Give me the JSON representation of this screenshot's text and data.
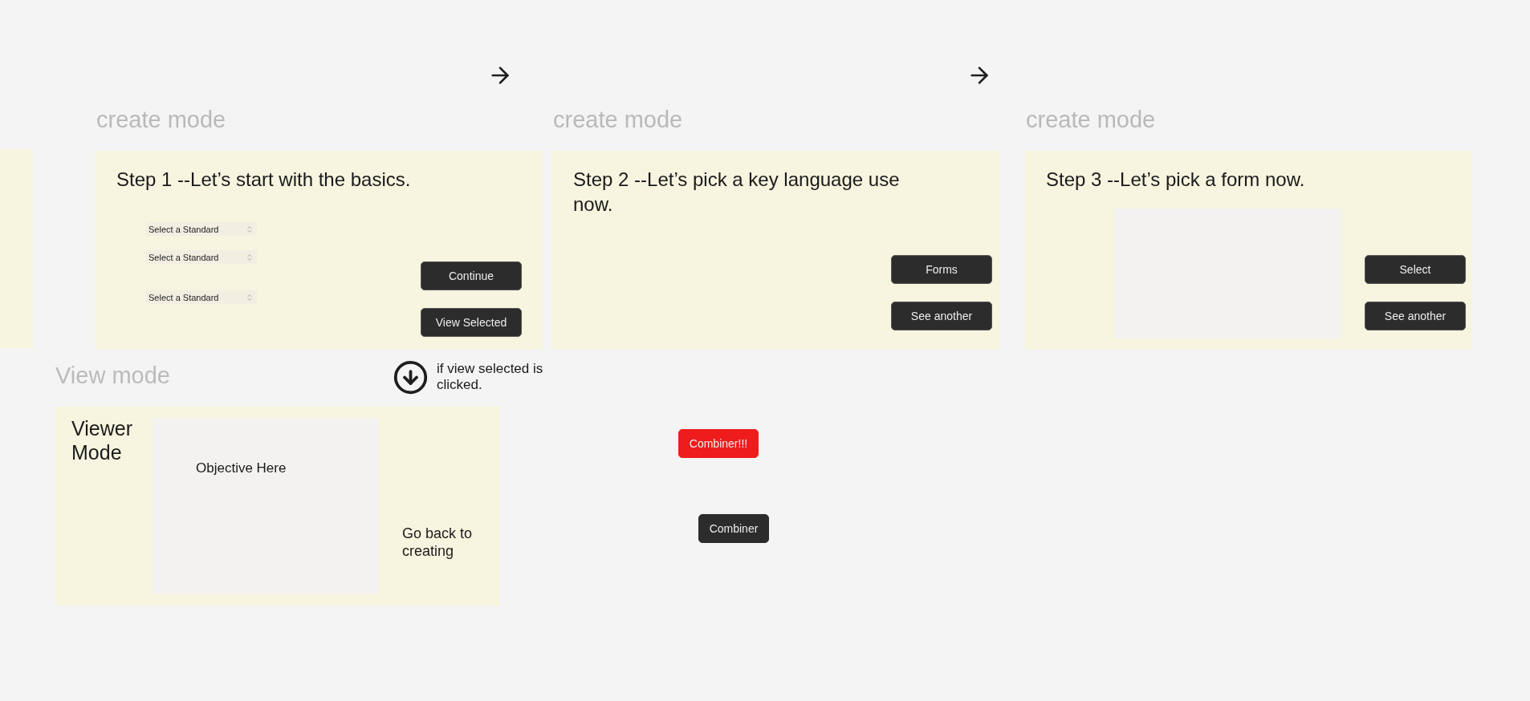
{
  "frames": [
    {
      "label": "create mode",
      "title": "Step 1 --Let’s start with the basics.",
      "selects": [
        "Select a Standard",
        "Select a Standard",
        "Select a Standard"
      ],
      "buttons": [
        "Continue",
        "View Selected"
      ]
    },
    {
      "label": "create mode",
      "title": "Step 2 --Let’s pick a key language use now.",
      "buttons": [
        "Forms",
        "See another"
      ]
    },
    {
      "label": "create mode",
      "title": "Step 3 --Let’s pick a form now.",
      "buttons": [
        "Select",
        "See another"
      ]
    }
  ],
  "view_frame": {
    "label": "View mode",
    "title": "Viewer Mode",
    "objective": "Objective Here",
    "back_text": "Go back to creating"
  },
  "note": "if view selected is clicked.",
  "loose_buttons": [
    {
      "label": "Combiner!!!",
      "color": "#ee1c1c"
    },
    {
      "label": "Combiner",
      "color": "#2c2c2c"
    }
  ]
}
